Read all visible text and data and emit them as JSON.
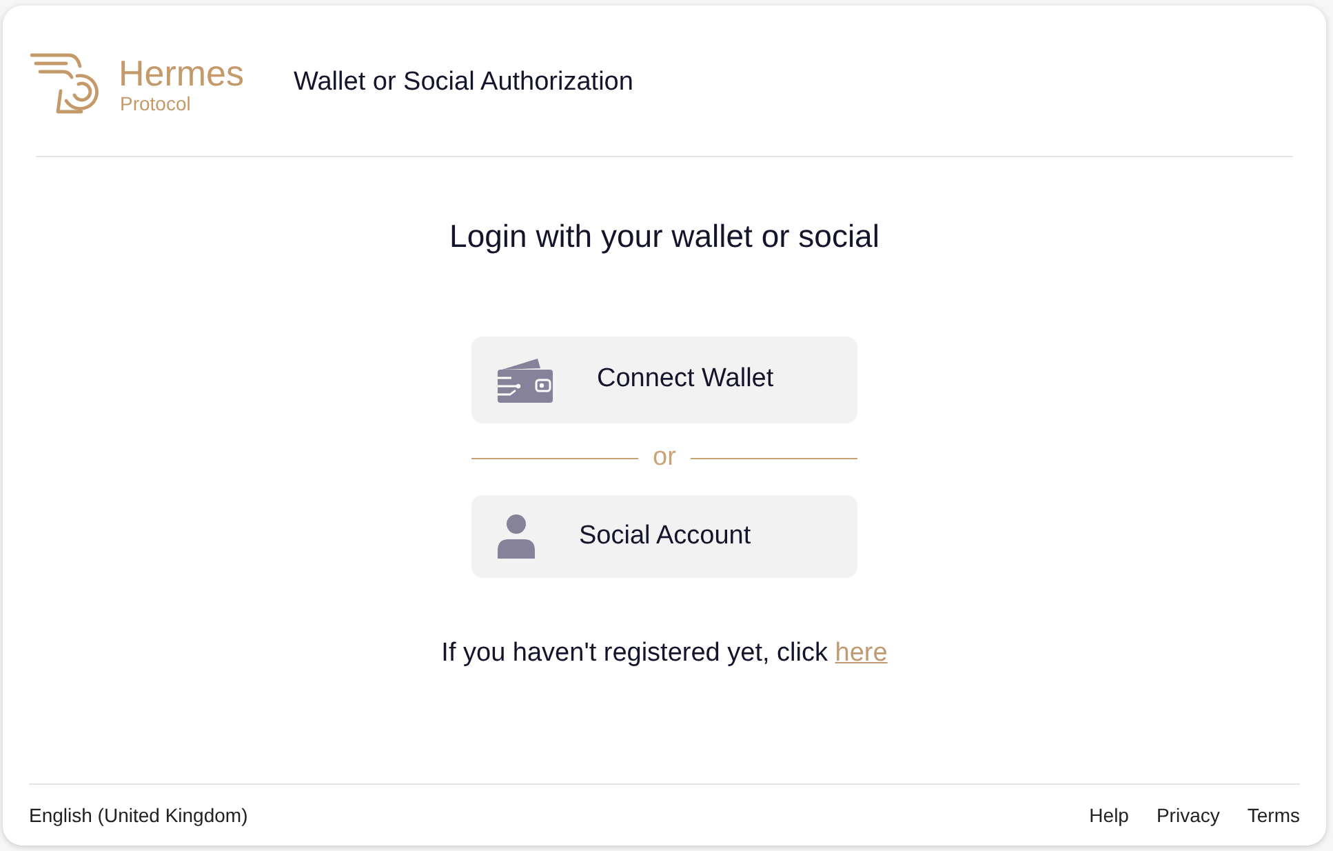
{
  "logo": {
    "name": "Hermes",
    "subtitle": "Protocol"
  },
  "header": {
    "title": "Wallet or Social Authorization"
  },
  "main": {
    "heading": "Login with your wallet or social",
    "options": [
      {
        "kind": "wallet",
        "label": "Connect Wallet"
      },
      {
        "kind": "social",
        "label": "Social Account"
      }
    ],
    "separator": "or",
    "register_prompt": {
      "text": "If you haven't registered yet, click",
      "link": "here"
    }
  },
  "footer": {
    "language": "English (United Kingdom)",
    "links": [
      "Help",
      "Privacy",
      "Terms"
    ]
  }
}
